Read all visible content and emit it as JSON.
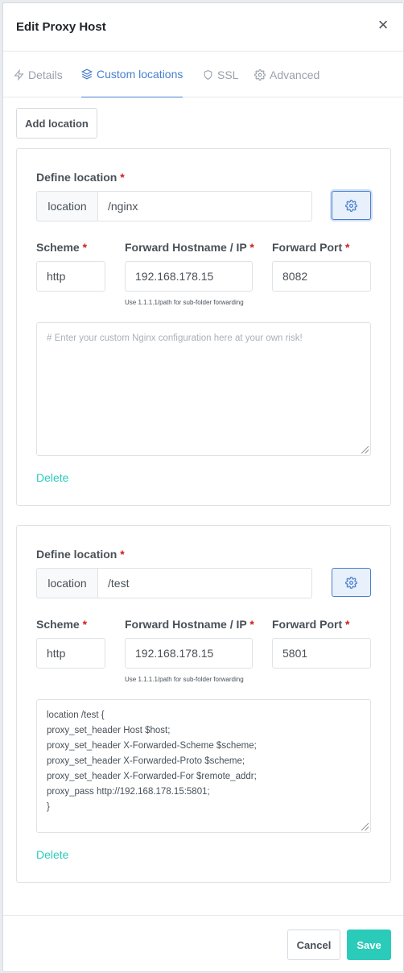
{
  "modal": {
    "title": "Edit Proxy Host"
  },
  "tabs": [
    {
      "label": "Details",
      "icon": "zap-icon"
    },
    {
      "label": "Custom locations",
      "icon": "layers-icon",
      "active": true
    },
    {
      "label": "SSL",
      "icon": "shield-icon"
    },
    {
      "label": "Advanced",
      "icon": "gear-icon"
    }
  ],
  "add_location_label": "Add location",
  "labels": {
    "define_location": "Define location",
    "scheme": "Scheme",
    "forward_hostname": "Forward Hostname / IP",
    "forward_port": "Forward Port",
    "required_mark": "*",
    "location_addon": "location",
    "delete": "Delete"
  },
  "help_text": "Use 1.1.1.1/path for sub-folder forwarding",
  "textarea_placeholder": "# Enter your custom Nginx configuration here at your own risk!",
  "locations": [
    {
      "path": "/nginx",
      "scheme": "http",
      "hostname": "192.168.178.15",
      "port": "8082",
      "config": ""
    },
    {
      "path": "/test",
      "scheme": "http",
      "hostname": "192.168.178.15",
      "port": "5801",
      "config_lines": [
        "location /test {",
        "proxy_set_header Host $host;",
        "proxy_set_header X-Forwarded-Scheme $scheme;",
        "proxy_set_header X-Forwarded-Proto $scheme;",
        "proxy_set_header X-Forwarded-For $remote_addr;",
        "proxy_pass http://192.168.178.15:5801;",
        "}"
      ]
    }
  ],
  "footer": {
    "cancel_label": "Cancel",
    "save_label": "Save"
  },
  "colors": {
    "accent": "#467fcf",
    "teal": "#2bcbba",
    "required": "#cd201f"
  }
}
